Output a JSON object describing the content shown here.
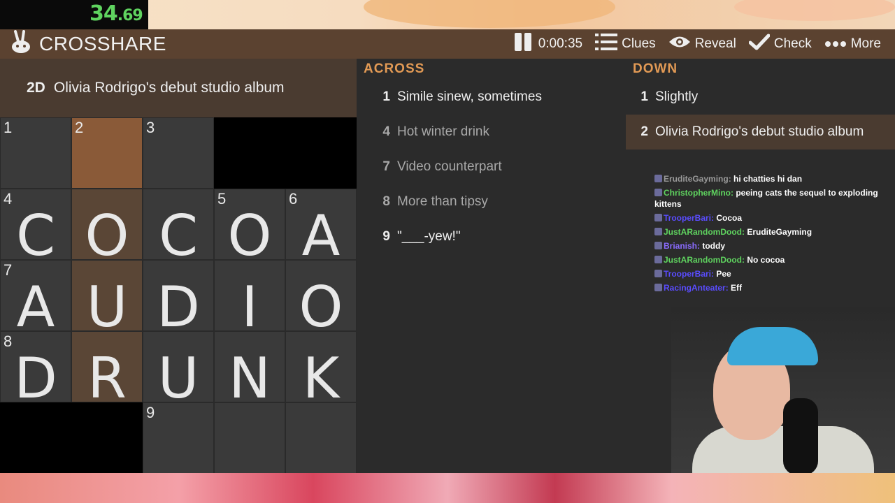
{
  "timer": {
    "seconds": "34",
    "fraction": ".69"
  },
  "header": {
    "logo_text": "CROSSHARE",
    "elapsed": "0:00:35",
    "clues_label": "Clues",
    "reveal_label": "Reveal",
    "check_label": "Check",
    "more_label": "More"
  },
  "banner": {
    "number": "2D",
    "text": "Olivia Rodrigo's debut studio album"
  },
  "grid": {
    "rows": [
      [
        {
          "n": "1",
          "c": ""
        },
        {
          "n": "2",
          "c": ""
        },
        {
          "n": "3",
          "c": ""
        },
        {
          "block": true
        },
        {
          "block": true
        }
      ],
      [
        {
          "n": "4",
          "c": "C"
        },
        {
          "n": "",
          "c": "O"
        },
        {
          "n": "",
          "c": "C"
        },
        {
          "n": "5",
          "c": "O"
        },
        {
          "n": "6",
          "c": "A"
        }
      ],
      [
        {
          "n": "7",
          "c": "A"
        },
        {
          "n": "",
          "c": "U"
        },
        {
          "n": "",
          "c": "D"
        },
        {
          "n": "",
          "c": "I"
        },
        {
          "n": "",
          "c": "O"
        }
      ],
      [
        {
          "n": "8",
          "c": "D"
        },
        {
          "n": "",
          "c": "R"
        },
        {
          "n": "",
          "c": "U"
        },
        {
          "n": "",
          "c": "N"
        },
        {
          "n": "",
          "c": "K"
        }
      ],
      [
        {
          "block": true
        },
        {
          "block": true
        },
        {
          "n": "9",
          "c": ""
        },
        {
          "n": "",
          "c": ""
        },
        {
          "n": "",
          "c": ""
        }
      ]
    ]
  },
  "across": {
    "heading": "ACROSS",
    "items": [
      {
        "num": "1",
        "text": "Simile sinew, sometimes"
      },
      {
        "num": "4",
        "text": "Hot winter drink"
      },
      {
        "num": "7",
        "text": "Video counterpart"
      },
      {
        "num": "8",
        "text": "More than tipsy"
      },
      {
        "num": "9",
        "text": "\"___-yew!\""
      }
    ]
  },
  "down": {
    "heading": "DOWN",
    "items": [
      {
        "num": "1",
        "text": "Slightly"
      },
      {
        "num": "2",
        "text": "Olivia Rodrigo's debut studio album"
      }
    ]
  },
  "chat": [
    {
      "user": "EruditeGayming",
      "msg": "hi chatties hi dan",
      "color": "#9a9a9a"
    },
    {
      "user": "ChristopherMino",
      "msg": "peeing cats the sequel to exploding kittens",
      "color": "#5fd35f"
    },
    {
      "user": "TrooperBari",
      "msg": "Cocoa",
      "color": "#5a4cff"
    },
    {
      "user": "JustARandomDood",
      "msg": "EruditeGayming",
      "color": "#5fd35f"
    },
    {
      "user": "Brianish",
      "msg": "toddy",
      "color": "#8a6bff"
    },
    {
      "user": "JustARandomDood",
      "msg": "No cocoa",
      "color": "#5fd35f"
    },
    {
      "user": "TrooperBari",
      "msg": "Pee",
      "color": "#5a4cff"
    },
    {
      "user": "RacingAnteater",
      "msg": "Eff",
      "color": "#5a4cff"
    }
  ]
}
